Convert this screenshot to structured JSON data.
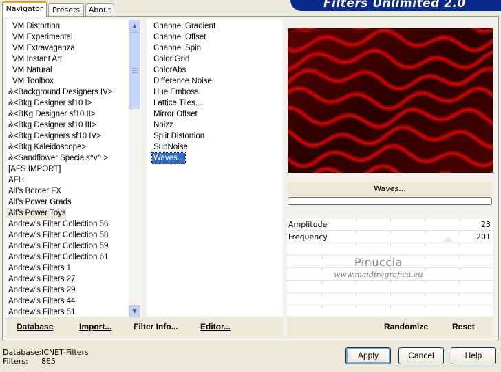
{
  "app": {
    "title": "Filters Unlimited 2.0"
  },
  "tabs": [
    {
      "label": "Navigator",
      "active": true
    },
    {
      "label": "Presets",
      "active": false
    },
    {
      "label": "About",
      "active": false
    }
  ],
  "categories": {
    "items": [
      "VM Distortion",
      "VM Experimental",
      "VM Extravaganza",
      "VM Instant Art",
      "VM Natural",
      "VM Toolbox",
      "&<Background Designers IV>",
      "&<Bkg Designer sf10 I>",
      "&<BKg Designer sf10 II>",
      "&<Bkg Designer sf10 III>",
      "&<Bkg Designers sf10 IV>",
      "&<Bkg Kaleidoscope>",
      "&<Sandflower Specials^v^ >",
      "[AFS IMPORT]",
      "AFH",
      "Alf's Border FX",
      "Alf's Power Grads",
      "Alf's Power Toys",
      "Andrew's Filter Collection 56",
      "Andrew's Filter Collection 58",
      "Andrew's Filter Collection 59",
      "Andrew's Filter Collection 61",
      "Andrew's Filters 1",
      "Andrew's Filters 27",
      "Andrew's Filters 29",
      "Andrew's Filters 44",
      "Andrew's Filters 51"
    ],
    "selected_index": 17
  },
  "filters": {
    "items": [
      "Channel Gradient",
      "Channel Offset",
      "Channel Spin",
      "Color Grid",
      "ColorAbs",
      "Difference Noise",
      "Hue Emboss",
      "Lattice Tiles....",
      "Mirror Offset",
      "Noizz",
      "Split Distortion",
      "SubNoise",
      "Waves..."
    ],
    "selected_index": 12
  },
  "preview": {
    "filter_name": "Waves...",
    "progress": 0
  },
  "params": [
    {
      "label": "Amplitude",
      "value": "23"
    },
    {
      "label": "Frequency",
      "value": "201"
    }
  ],
  "watermark": {
    "line1": "Pinuccia",
    "line2": "www.maidiregrafica.eu"
  },
  "left_buttons": {
    "database": "Database",
    "import": "Import...",
    "filter_info": "Filter Info...",
    "editor": "Editor..."
  },
  "right_buttons": {
    "randomize": "Randomize",
    "reset": "Reset"
  },
  "status": {
    "database_label": "Database:",
    "database_value": "ICNET-Filters",
    "filters_label": "Filters:",
    "filters_value": "865"
  },
  "dialog_buttons": {
    "apply": "Apply",
    "cancel": "Cancel",
    "help": "Help"
  },
  "colors": {
    "selection": "#316ac5",
    "title_banner": "#0a2a8c",
    "preview_dark": "#3a0000",
    "preview_red": "#b00000"
  }
}
